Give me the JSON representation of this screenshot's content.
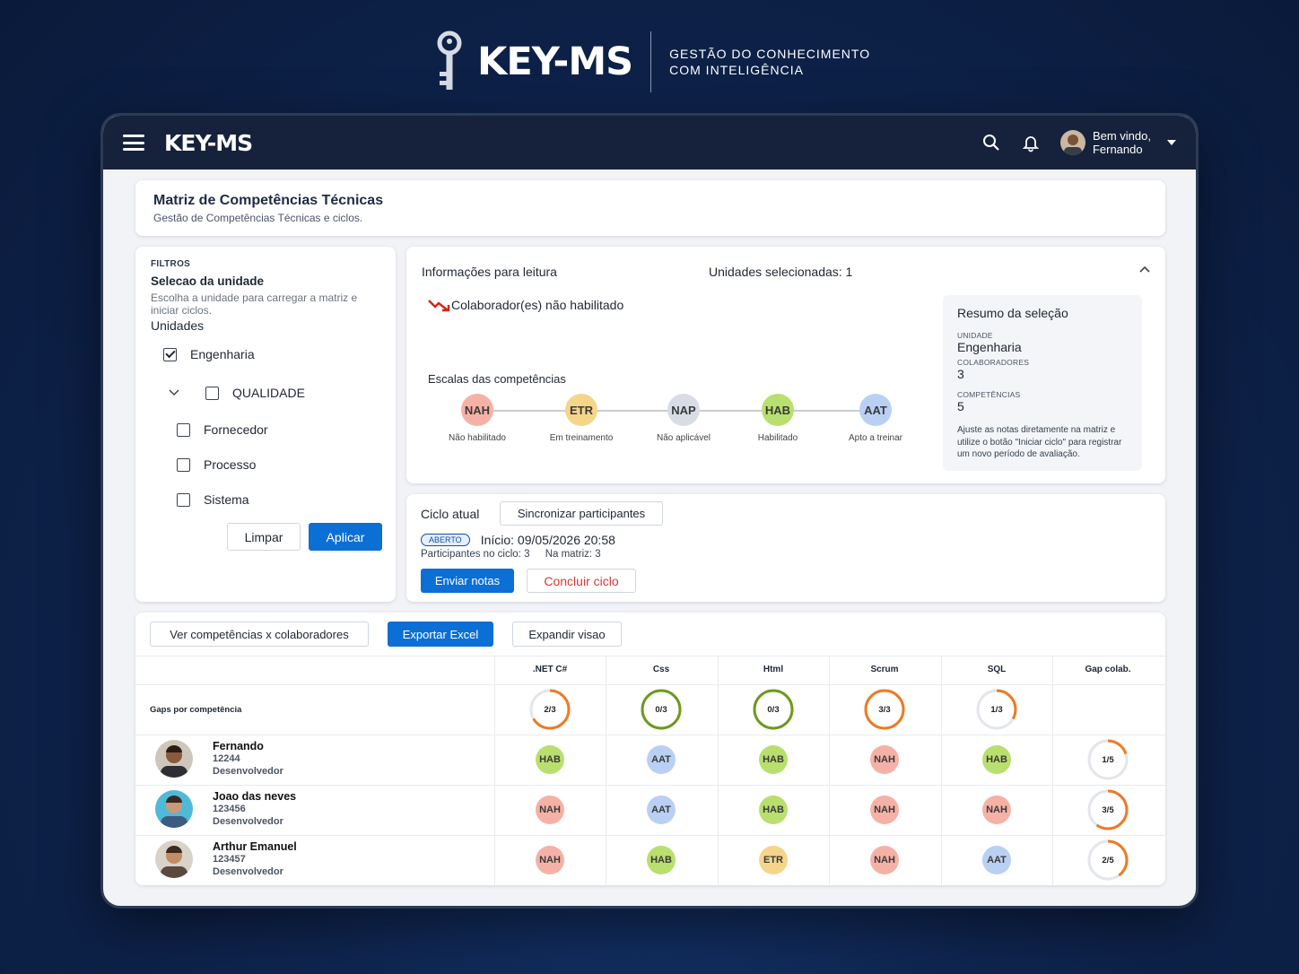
{
  "brand": {
    "logo": "KEY-MS",
    "tagline_1": "GESTÃO DO CONHECIMENTO",
    "tagline_2": "COM INTELIGÊNCIA"
  },
  "topbar": {
    "app_name": "KEY-MS",
    "welcome": "Bem vindo,",
    "user_name": "Fernando"
  },
  "header": {
    "title": "Matriz de Competências Técnicas",
    "subtitle": "Gestão de Competências Técnicas e ciclos."
  },
  "filters": {
    "section": "FILTROS",
    "title": "Selecao da unidade",
    "hint": "Escolha a unidade para carregar a matriz e iniciar ciclos.",
    "units_label": "Unidades",
    "units": [
      {
        "label": "Engenharia",
        "checked": true
      },
      {
        "label": "QUALIDADE",
        "checked": false
      },
      {
        "label": "Fornecedor",
        "checked": false
      },
      {
        "label": "Processo",
        "checked": false
      },
      {
        "label": "Sistema",
        "checked": false
      }
    ],
    "clear": "Limpar",
    "apply": "Aplicar"
  },
  "info": {
    "title": "Informações para leitura",
    "selected_units_label": "Unidades selecionadas:",
    "selected_units_value": "1",
    "alert": "Colaborador(es) não habilitado",
    "scales_title": "Escalas das competências",
    "scales": [
      {
        "code": "NAH",
        "label": "Não habilitado"
      },
      {
        "code": "ETR",
        "label": "Em treinamento"
      },
      {
        "code": "NAP",
        "label": "Não aplicável"
      },
      {
        "code": "HAB",
        "label": "Habilitado"
      },
      {
        "code": "AAT",
        "label": "Apto a treinar"
      }
    ],
    "summary": {
      "title": "Resumo da seleção",
      "unit_label": "UNIDADE",
      "unit_value": "Engenharia",
      "collab_label": "COLABORADORES",
      "collab_value": "3",
      "comp_label": "COMPETÊNCIAS",
      "comp_value": "5",
      "note": "Ajuste as notas diretamente na matriz e utilize o botão \"Iniciar ciclo\" para registrar um novo período de avaliação."
    }
  },
  "cycle": {
    "title": "Ciclo atual",
    "sync": "Sincronizar participantes",
    "status": "ABERTO",
    "start": "Início: 09/05/2026 20:58",
    "participants_label": "Participantes no ciclo:",
    "participants_value": "3",
    "matrix_label": "Na matriz:",
    "matrix_value": "3",
    "send": "Enviar notas",
    "close": "Concluir ciclo"
  },
  "matrix": {
    "btn_view": "Ver competências x colaboradores",
    "btn_export": "Exportar Excel",
    "btn_expand": "Expandir visao",
    "columns": [
      ".NET C#",
      "Css",
      "Html",
      "Scrum",
      "SQL",
      "Gap colab."
    ],
    "gaps_label": "Gaps por competência",
    "gaps": [
      {
        "text": "2/3",
        "fraction": 0.6667,
        "color": "#f07a22"
      },
      {
        "text": "0/3",
        "fraction": 1.0,
        "color": "#6d9a1f"
      },
      {
        "text": "0/3",
        "fraction": 1.0,
        "color": "#6d9a1f"
      },
      {
        "text": "3/3",
        "fraction": 1.0,
        "color": "#f07a22"
      },
      {
        "text": "1/3",
        "fraction": 0.3333,
        "color": "#f07a22"
      }
    ],
    "people": [
      {
        "name": "Fernando",
        "id": "12244",
        "role": "Desenvolvedor",
        "cells": [
          "HAB",
          "AAT",
          "HAB",
          "NAH",
          "HAB"
        ],
        "gap": {
          "text": "1/5",
          "fraction": 0.2
        }
      },
      {
        "name": "Joao das neves",
        "id": "123456",
        "role": "Desenvolvedor",
        "cells": [
          "NAH",
          "AAT",
          "HAB",
          "NAH",
          "NAH"
        ],
        "gap": {
          "text": "3/5",
          "fraction": 0.6
        }
      },
      {
        "name": "Arthur Emanuel",
        "id": "123457",
        "role": "Desenvolvedor",
        "cells": [
          "NAH",
          "HAB",
          "ETR",
          "NAH",
          "AAT"
        ],
        "gap": {
          "text": "2/5",
          "fraction": 0.4
        }
      }
    ]
  }
}
